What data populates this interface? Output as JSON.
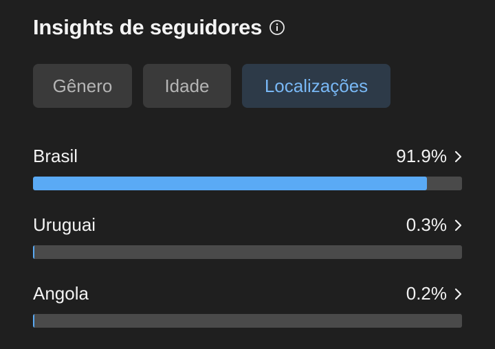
{
  "header": {
    "title": "Insights de seguidores",
    "info_icon": "info-icon"
  },
  "tabs": [
    {
      "label": "Gênero",
      "active": false
    },
    {
      "label": "Idade",
      "active": false
    },
    {
      "label": "Localizações",
      "active": true
    }
  ],
  "locations": [
    {
      "country": "Brasil",
      "percent_label": "91.9%",
      "percent": 91.9
    },
    {
      "country": "Uruguai",
      "percent_label": "0.3%",
      "percent": 0.3
    },
    {
      "country": "Angola",
      "percent_label": "0.2%",
      "percent": 0.2
    }
  ],
  "colors": {
    "background": "#1f1f1f",
    "bar_fill": "#5aaaf5",
    "bar_track": "#4a4a4a",
    "active_tab_bg": "#2d3a48",
    "active_tab_text": "#79b8f5"
  }
}
